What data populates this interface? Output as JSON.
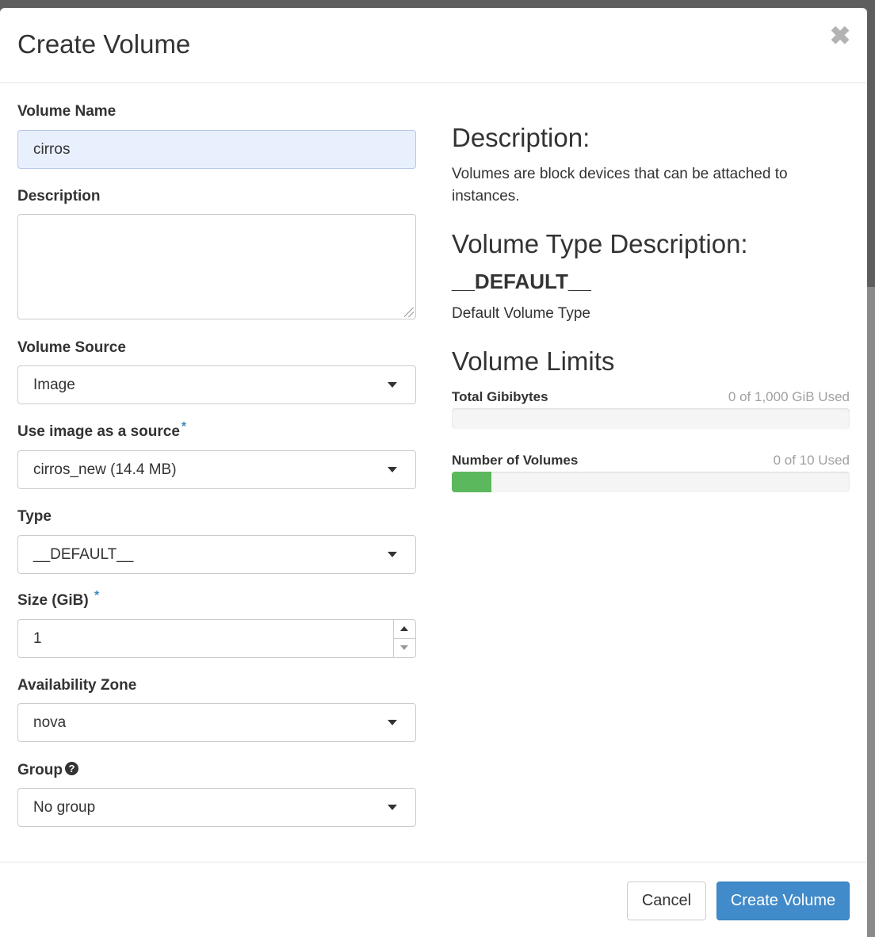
{
  "modal": {
    "title": "Create Volume",
    "close_symbol": "✖"
  },
  "form": {
    "volume_name": {
      "label": "Volume Name",
      "value": "cirros"
    },
    "description": {
      "label": "Description",
      "value": ""
    },
    "volume_source": {
      "label": "Volume Source",
      "selected": "Image"
    },
    "image_source": {
      "label": "Use image as a source",
      "required_mark": "*",
      "selected": "cirros_new (14.4 MB)"
    },
    "type": {
      "label": "Type",
      "selected": "__DEFAULT__"
    },
    "size": {
      "label": "Size (GiB)",
      "required_mark": "*",
      "value": "1"
    },
    "availability_zone": {
      "label": "Availability Zone",
      "selected": "nova"
    },
    "group": {
      "label": "Group",
      "help_symbol": "?",
      "selected": "No group"
    }
  },
  "info": {
    "description_heading": "Description:",
    "description_text": "Volumes are block devices that can be attached to instances.",
    "type_heading": "Volume Type Description:",
    "type_name": "__DEFAULT__",
    "type_text": "Default Volume Type",
    "limits_heading": "Volume Limits",
    "limits": [
      {
        "label": "Total Gibibytes",
        "used_text": "0 of 1,000 GiB Used",
        "fill_fraction": 0.0,
        "color": "#5cb85c"
      },
      {
        "label": "Number of Volumes",
        "used_text": "0 of 10 Used",
        "fill_fraction": 0.1,
        "color": "#5cb85c"
      }
    ]
  },
  "footer": {
    "cancel_label": "Cancel",
    "submit_label": "Create Volume"
  },
  "colors": {
    "primary": "#428bca",
    "required": "#3c8dbc",
    "success": "#5cb85c",
    "autofill": "#e8f0fe"
  },
  "icons": {
    "close": "close-icon",
    "dropdown": "caret-down-icon",
    "help": "question-circle-icon",
    "resize": "resize-handle-icon"
  }
}
